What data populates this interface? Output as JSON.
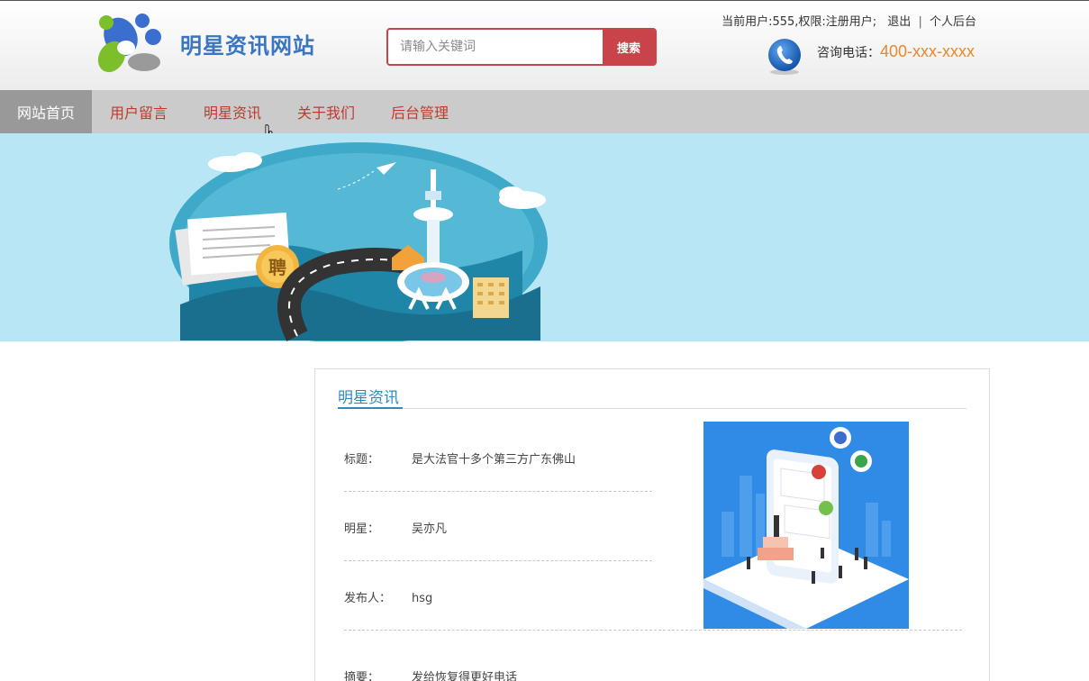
{
  "header": {
    "site_title": "明星资讯网站",
    "search_placeholder": "请输入关键词",
    "search_button": "搜索",
    "user_info": "当前用户:555,权限:注册用户;",
    "logout": "退出",
    "separator": "|",
    "personal_backend": "个人后台",
    "phone_label": "咨询电话：",
    "phone_number": "400-xxx-xxxx"
  },
  "nav": {
    "items": [
      {
        "label": "网站首页",
        "active": true
      },
      {
        "label": "用户留言",
        "active": false
      },
      {
        "label": "明星资讯",
        "active": false
      },
      {
        "label": "关于我们",
        "active": false
      },
      {
        "label": "后台管理",
        "active": false
      }
    ]
  },
  "banner": {
    "badge_text": "聘"
  },
  "detail": {
    "section_title": "明星资讯",
    "fields": [
      {
        "label": "标题：",
        "value": "是大法官十多个第三方广东佛山"
      },
      {
        "label": "明星：",
        "value": "吴亦凡"
      },
      {
        "label": "发布人：",
        "value": "hsg"
      },
      {
        "label": "摘要：",
        "value": "发给恢复得更好电话"
      }
    ]
  },
  "colors": {
    "accent_red": "#c9444a",
    "title_blue": "#3a76c0",
    "phone_orange": "#e8882a",
    "section_blue": "#2d8bb8",
    "banner_bg": "#b8e6f5"
  },
  "icons": {
    "logo": "logo-icon",
    "phone": "phone-icon",
    "cursor": "hand-cursor-icon"
  }
}
